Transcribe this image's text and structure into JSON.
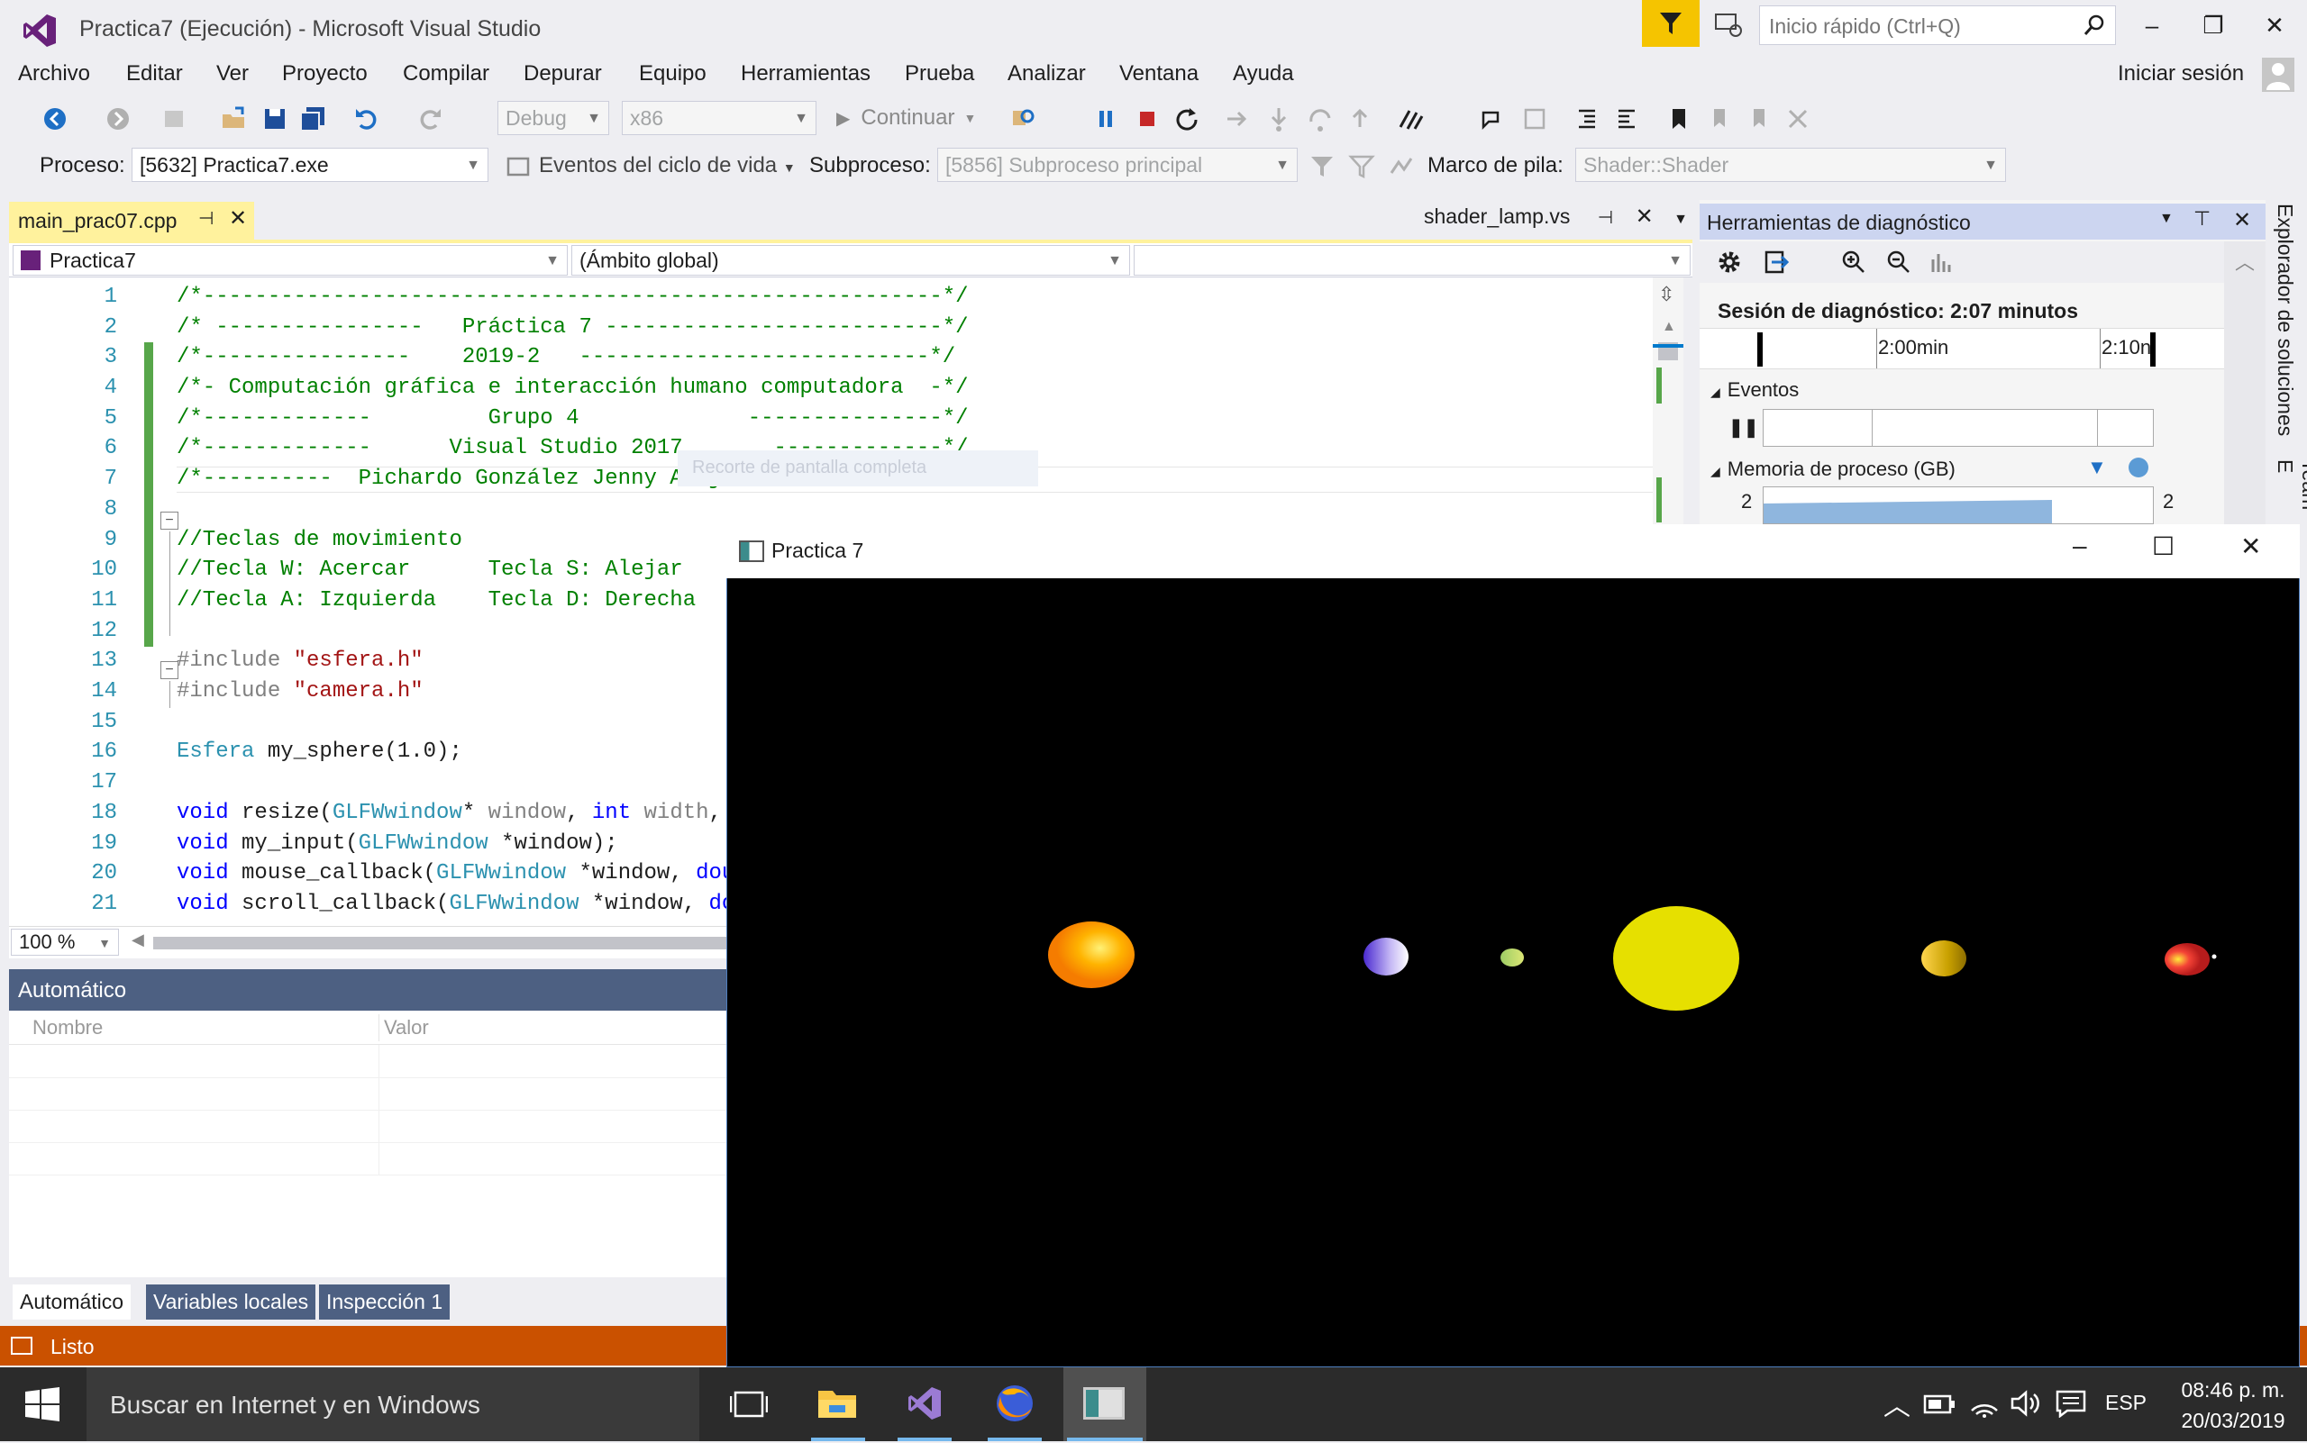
{
  "window": {
    "title": "Practica7 (Ejecución) - Microsoft Visual Studio",
    "quick_launch_placeholder": "Inicio rápido (Ctrl+Q)",
    "controls": [
      "–",
      "❐",
      "✕"
    ]
  },
  "menu": {
    "items": [
      "Archivo",
      "Editar",
      "Ver",
      "Proyecto",
      "Compilar",
      "Depurar",
      "Equipo",
      "Herramientas",
      "Prueba",
      "Analizar",
      "Ventana",
      "Ayuda"
    ],
    "signin": "Iniciar sesión"
  },
  "toolbar": {
    "config": "Debug",
    "platform": "x86",
    "continue": "Continuar"
  },
  "debug_location": {
    "process_label": "Proceso:",
    "process_value": "[5632] Practica7.exe",
    "lifecycle_label": "Eventos del ciclo de vida",
    "thread_label": "Subproceso:",
    "thread_value": "[5856] Subproceso principal",
    "stack_label": "Marco de pila:",
    "stack_value": "Shader::Shader"
  },
  "editor": {
    "active_tab": "main_prac07.cpp",
    "other_tab": "shader_lamp.vs",
    "nav_project": "Practica7",
    "nav_scope": "(Ámbito global)",
    "zoom": "100 %",
    "ghost_text": "Recorte de pantalla completa",
    "lines": [
      {
        "n": "1",
        "segs": [
          {
            "t": "/*---------------------------------------------------------*/",
            "c": "cm"
          }
        ]
      },
      {
        "n": "2",
        "segs": [
          {
            "t": "/* ----------------   Práctica 7 --------------------------*/",
            "c": "cm"
          }
        ]
      },
      {
        "n": "3",
        "segs": [
          {
            "t": "/*----------------    2019-2   ---------------------------*/",
            "c": "cm"
          }
        ]
      },
      {
        "n": "4",
        "segs": [
          {
            "t": "/*- Computación gráfica e interacción humano computadora  -*/",
            "c": "cm"
          }
        ]
      },
      {
        "n": "5",
        "segs": [
          {
            "t": "/*-------------         Grupo 4             ---------------*/",
            "c": "cm"
          }
        ]
      },
      {
        "n": "6",
        "segs": [
          {
            "t": "/*-------------      Visual Studio 2017       -------------*/",
            "c": "cm"
          }
        ]
      },
      {
        "n": "7",
        "segs": [
          {
            "t": "/*----------  Pichardo González Jenny Alejandra  ----------*/",
            "c": "cm"
          }
        ]
      },
      {
        "n": "8",
        "segs": []
      },
      {
        "n": "9",
        "segs": [
          {
            "t": "//Teclas de movimiento",
            "c": "cm"
          }
        ]
      },
      {
        "n": "10",
        "segs": [
          {
            "t": "//Tecla W: Acercar      Tecla S: Alejar",
            "c": "cm"
          }
        ]
      },
      {
        "n": "11",
        "segs": [
          {
            "t": "//Tecla A: Izquierda    Tecla D: Derecha",
            "c": "cm"
          }
        ]
      },
      {
        "n": "12",
        "segs": []
      },
      {
        "n": "13",
        "segs": [
          {
            "t": "#include ",
            "c": "pp"
          },
          {
            "t": "\"esfera.h\"",
            "c": "str"
          }
        ]
      },
      {
        "n": "14",
        "segs": [
          {
            "t": "#include ",
            "c": "pp"
          },
          {
            "t": "\"camera.h\"",
            "c": "str"
          }
        ]
      },
      {
        "n": "15",
        "segs": []
      },
      {
        "n": "16",
        "segs": [
          {
            "t": "Esfera",
            "c": "typ"
          },
          {
            "t": " my_sphere(1.0);",
            "c": "pl"
          }
        ]
      },
      {
        "n": "17",
        "segs": []
      },
      {
        "n": "18",
        "segs": [
          {
            "t": "void",
            "c": "kw"
          },
          {
            "t": " resize(",
            "c": "pl"
          },
          {
            "t": "GLFWwindow",
            "c": "typ"
          },
          {
            "t": "* ",
            "c": "pl"
          },
          {
            "t": "window",
            "c": "gr"
          },
          {
            "t": ", ",
            "c": "pl"
          },
          {
            "t": "int",
            "c": "kw"
          },
          {
            "t": " ",
            "c": "pl"
          },
          {
            "t": "width",
            "c": "gr"
          },
          {
            "t": ", ",
            "c": "pl"
          },
          {
            "t": "i",
            "c": "kw"
          }
        ]
      },
      {
        "n": "19",
        "segs": [
          {
            "t": "void",
            "c": "kw"
          },
          {
            "t": " my_input(",
            "c": "pl"
          },
          {
            "t": "GLFWwindow",
            "c": "typ"
          },
          {
            "t": " *window);",
            "c": "pl"
          }
        ]
      },
      {
        "n": "20",
        "segs": [
          {
            "t": "void",
            "c": "kw"
          },
          {
            "t": " mouse_callback(",
            "c": "pl"
          },
          {
            "t": "GLFWwindow",
            "c": "typ"
          },
          {
            "t": " *window, ",
            "c": "pl"
          },
          {
            "t": "doub",
            "c": "kw"
          }
        ]
      },
      {
        "n": "21",
        "segs": [
          {
            "t": "void",
            "c": "kw"
          },
          {
            "t": " scroll_callback(",
            "c": "pl"
          },
          {
            "t": "GLFWwindow",
            "c": "typ"
          },
          {
            "t": " *window, ",
            "c": "pl"
          },
          {
            "t": "dou",
            "c": "kw"
          }
        ]
      }
    ]
  },
  "diagnostics": {
    "title": "Herramientas de diagnóstico",
    "session": "Sesión de diagnóstico: 2:07 minutos",
    "tick1": "2:00min",
    "tick2": "2:10n",
    "events_label": "Eventos",
    "memory_label": "Memoria de proceso (GB)",
    "mem_left": "2",
    "mem_right": "2",
    "side_tab1": "Explorador de soluciones",
    "side_tab2": "Team E"
  },
  "autos": {
    "title": "Automático",
    "col_name": "Nombre",
    "col_value": "Valor",
    "tabs": [
      "Automático",
      "Variables locales",
      "Inspección 1"
    ]
  },
  "status": {
    "text": "Listo"
  },
  "app_window": {
    "title": "Practica 7",
    "controls": [
      "–",
      "☐",
      "✕"
    ]
  },
  "taskbar": {
    "search_placeholder": "Buscar en Internet y en Windows",
    "lang": "ESP",
    "time": "08:46 p. m.",
    "date": "20/03/2019"
  },
  "colors": {
    "accent": "#007ACC",
    "status_bar": "#CA5100",
    "tab_active": "#FFF29D",
    "comment_green": "#008000",
    "keyword_blue": "#0000FF",
    "type_teal": "#2B91AF",
    "string_red": "#A31515",
    "filter_yellow": "#F5C400"
  }
}
